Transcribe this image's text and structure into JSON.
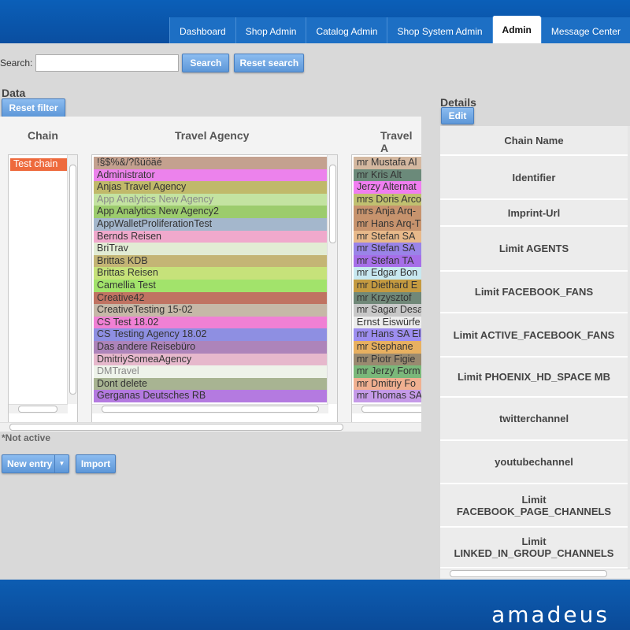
{
  "tabs": [
    {
      "label": "Dashboard",
      "active": false
    },
    {
      "label": "Shop Admin",
      "active": false
    },
    {
      "label": "Catalog Admin",
      "active": false
    },
    {
      "label": "Shop System Admin",
      "active": false
    },
    {
      "label": "Admin",
      "active": true
    },
    {
      "label": "Message Center",
      "active": false
    }
  ],
  "search": {
    "label": "Search:",
    "value": "",
    "search_button": "Search",
    "reset_button": "Reset search"
  },
  "data_section": {
    "title": "Data",
    "reset_filter": "Reset filter",
    "not_active_note": "*Not active"
  },
  "columns": {
    "chain": "Chain",
    "agency": "Travel Agency",
    "agent": "Travel A"
  },
  "chain_items": [
    {
      "label": "Test chain",
      "color": "#ee6a3d"
    }
  ],
  "agencies": [
    {
      "label": "!§$%&/?ßüöäé",
      "color": "#c4a18f",
      "inactive": false
    },
    {
      "label": "Administrator",
      "color": "#ec82ec",
      "inactive": false
    },
    {
      "label": "Anjas Travel Agency",
      "color": "#c0b96a",
      "inactive": false
    },
    {
      "label": "App Analytics New Agency",
      "color": "#c3e3a1",
      "inactive": true
    },
    {
      "label": "App Analytics New Agency2",
      "color": "#9ccc6d",
      "inactive": false
    },
    {
      "label": "AppWalletProliferationTest",
      "color": "#a4b7cc",
      "inactive": false
    },
    {
      "label": "Bernds Reisen",
      "color": "#f0a9cc",
      "inactive": false
    },
    {
      "label": "BriTrav",
      "color": "#e2ecd4",
      "inactive": false
    },
    {
      "label": "Brittas KDB",
      "color": "#c4b575",
      "inactive": false
    },
    {
      "label": "Brittas Reisen",
      "color": "#c6e27a",
      "inactive": false
    },
    {
      "label": "Camellia Test",
      "color": "#a2e36b",
      "inactive": false
    },
    {
      "label": "Creative42",
      "color": "#c07362",
      "inactive": false
    },
    {
      "label": "CreativeTesting 15-02",
      "color": "#c6b8a7",
      "inactive": false
    },
    {
      "label": "CS Test 18.02",
      "color": "#f080d4",
      "inactive": false
    },
    {
      "label": "CS Testing Agency 18.02",
      "color": "#8e8fe2",
      "inactive": false
    },
    {
      "label": "Das andere Reisebüro",
      "color": "#ad84ba",
      "inactive": false
    },
    {
      "label": "DmitriySomeaAgency",
      "color": "#e6b8cc",
      "inactive": false
    },
    {
      "label": "DMTravel",
      "color": "#eef3ea",
      "inactive": true
    },
    {
      "label": "Dont delete",
      "color": "#a8b492",
      "inactive": false
    },
    {
      "label": "Gerganas Deutsches RB",
      "color": "#b47ae0",
      "inactive": false
    }
  ],
  "agents": [
    {
      "label": "mr Mustafa Al",
      "color": "#d4b8a0"
    },
    {
      "label": "mr Kris Alt",
      "color": "#6b8a7a"
    },
    {
      "label": "Jerzy Alternat",
      "color": "#f07ef0"
    },
    {
      "label": "mrs Doris Arco",
      "color": "#c0c070"
    },
    {
      "label": "mrs Anja Arq-",
      "color": "#c7936d"
    },
    {
      "label": "mr Hans Arq-T",
      "color": "#c7936d"
    },
    {
      "label": "mr Stefan SA",
      "color": "#e8b98a"
    },
    {
      "label": "mr Stefan SA",
      "color": "#9a84e8"
    },
    {
      "label": "mr Stefan TA",
      "color": "#a66ee8"
    },
    {
      "label": "mr Edgar Bon",
      "color": "#c8e8f0"
    },
    {
      "label": "mr Diethard E",
      "color": "#c49a40"
    },
    {
      "label": "mr Krzysztof",
      "color": "#708878"
    },
    {
      "label": "mr Sagar Desa",
      "color": "#c8c8c8"
    },
    {
      "label": "Ernst Eiswürfe",
      "color": "#ececec"
    },
    {
      "label": "mr Hans SA El",
      "color": "#9d8ef0"
    },
    {
      "label": "mr Stephane",
      "color": "#e8b060"
    },
    {
      "label": "mr Piotr Figie",
      "color": "#9a8a70"
    },
    {
      "label": "mr Jerzy Form",
      "color": "#7ab87a"
    },
    {
      "label": "mr Dmitriy Fo",
      "color": "#f0b090"
    },
    {
      "label": "mr Thomas SA",
      "color": "#c59ae8"
    }
  ],
  "actions": {
    "new_entry": "New entry",
    "import": "Import"
  },
  "details": {
    "title": "Details",
    "edit": "Edit",
    "fields": [
      "Chain Name",
      "Identifier",
      "Imprint-Url",
      "Limit AGENTS",
      "Limit FACEBOOK_FANS",
      "Limit ACTIVE_FACEBOOK_FANS",
      "Limit PHOENIX_HD_SPACE MB",
      "twitterchannel",
      "youtubechannel",
      "Limit FACEBOOK_PAGE_CHANNELS",
      "Limit LINKED_IN_GROUP_CHANNELS"
    ]
  },
  "brand": {
    "logo": "amadeus"
  },
  "colors": {
    "header_blue": "#0b5fb8",
    "button_blue": "#5d97d8"
  }
}
